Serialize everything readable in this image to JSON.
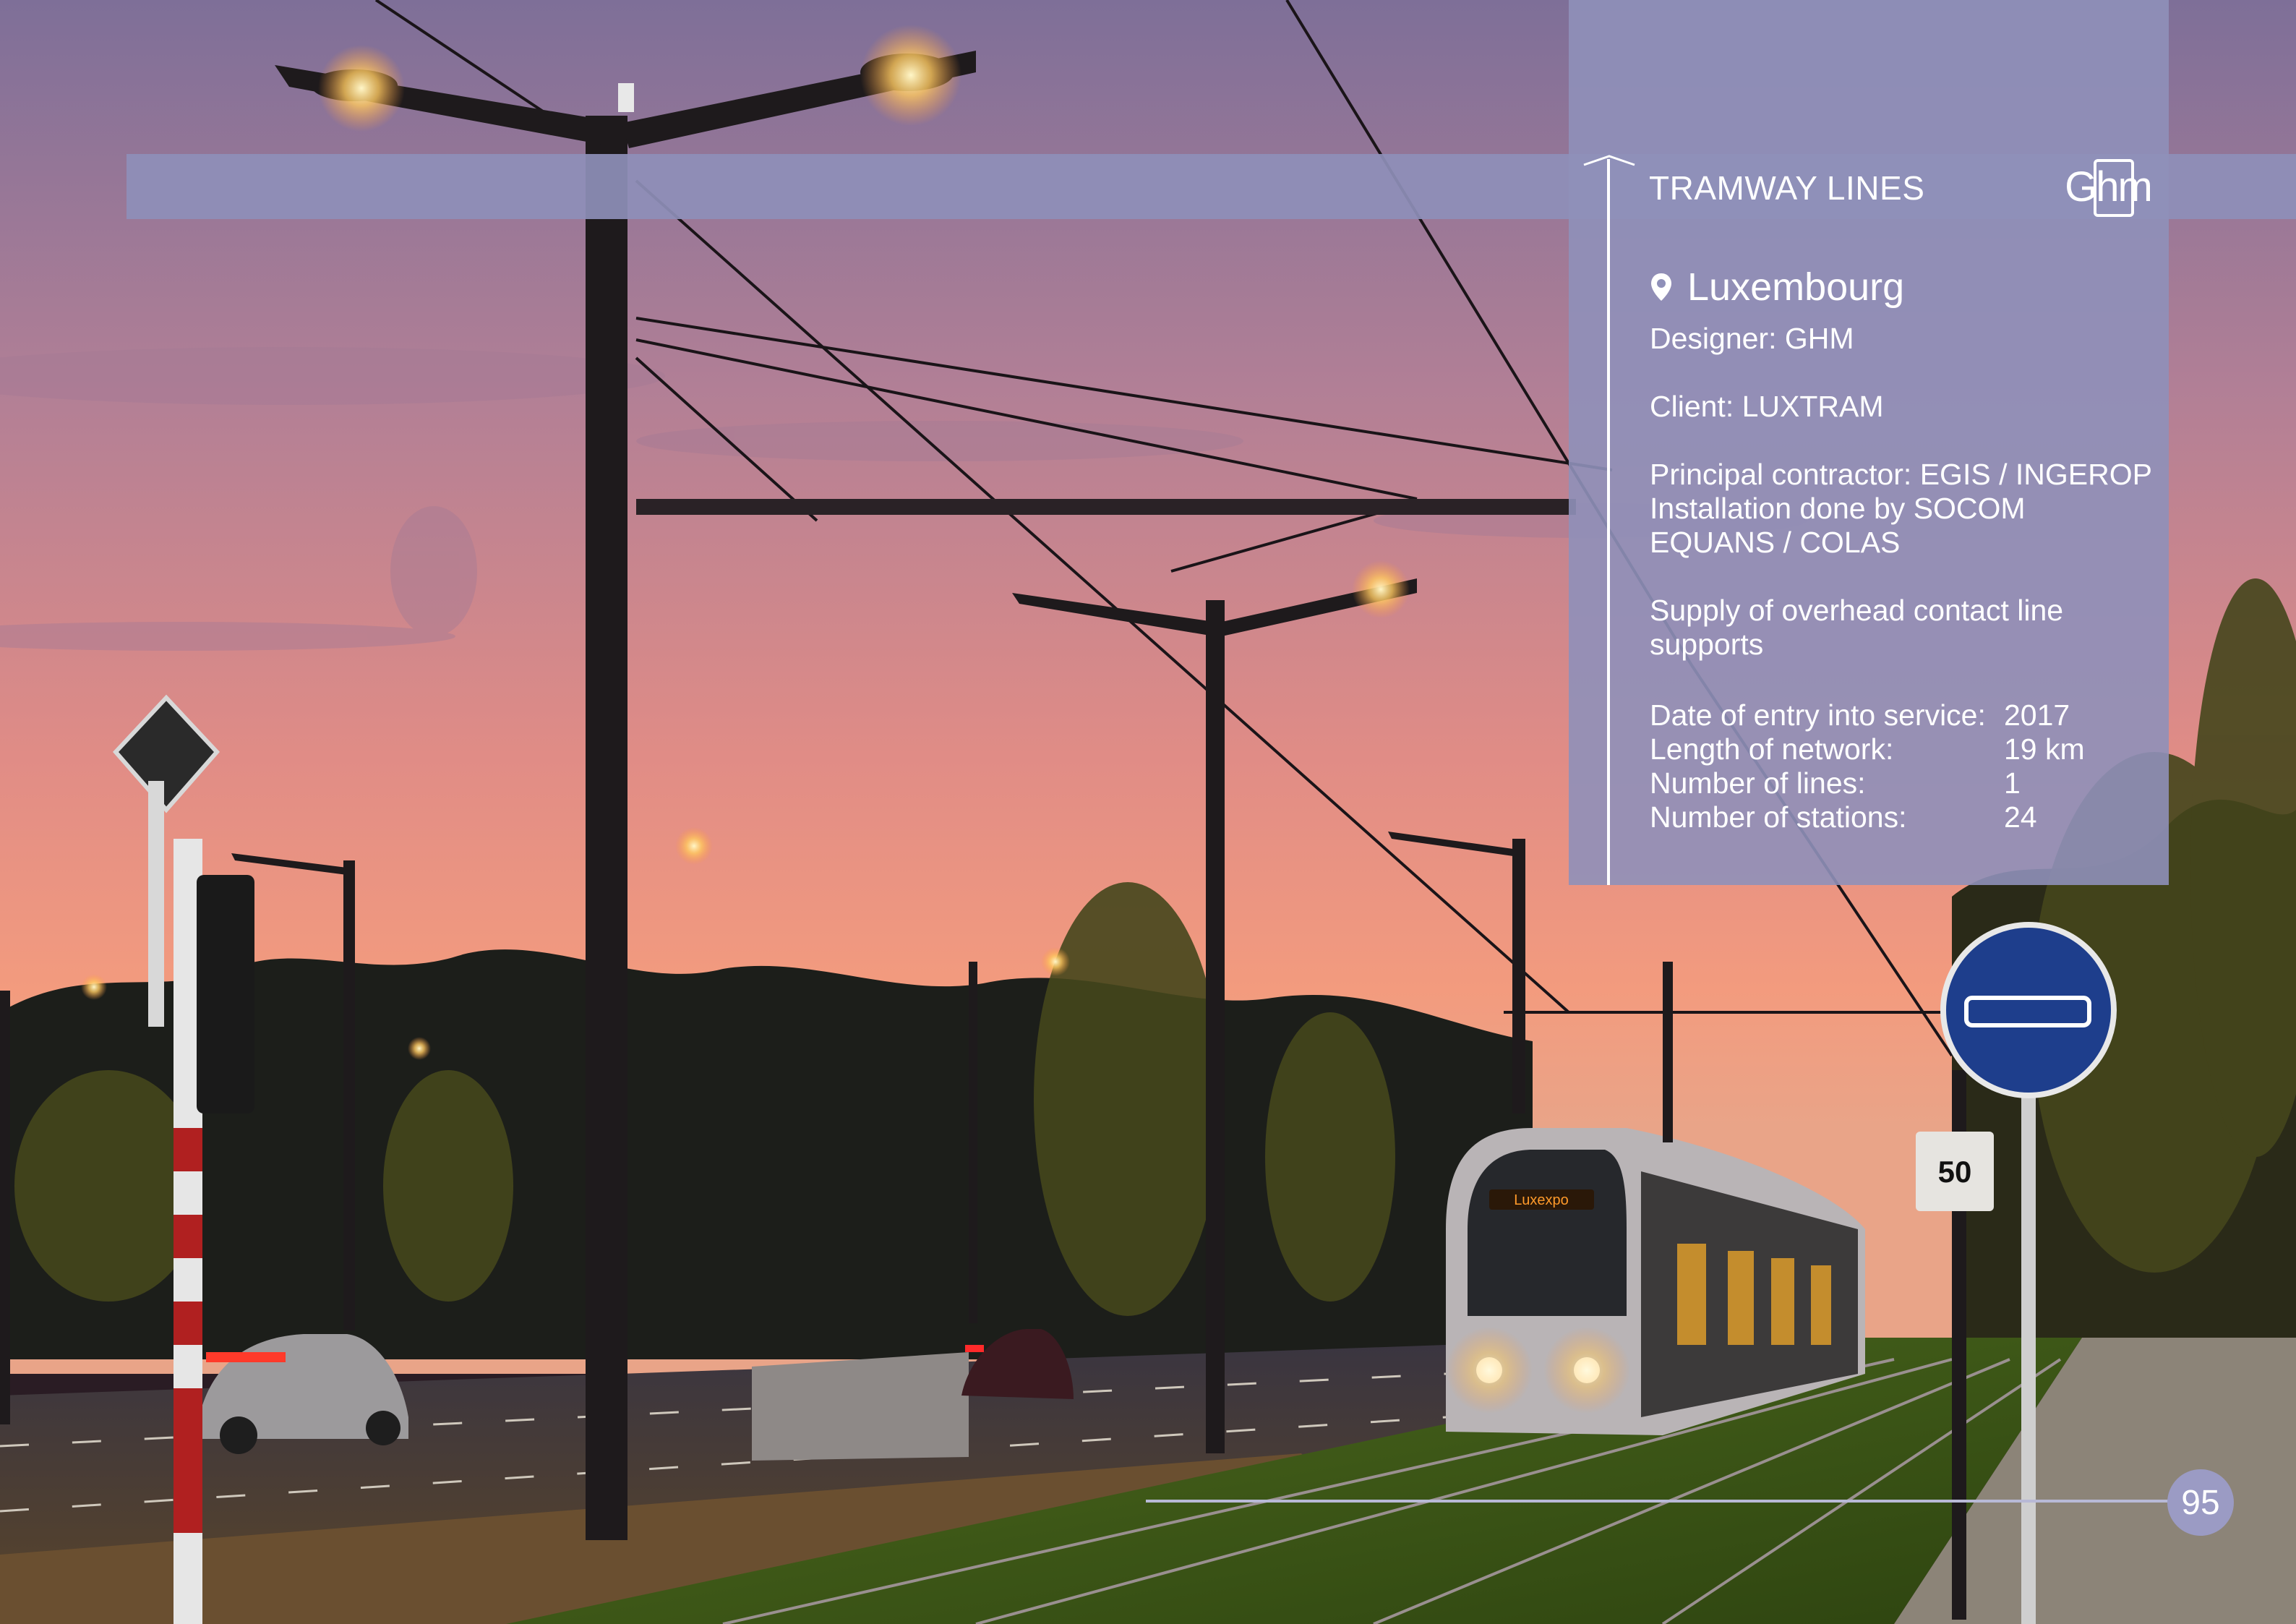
{
  "header": {
    "title": "TRAMWAY LINES",
    "logo_text": "Ghm"
  },
  "project": {
    "location": "Luxembourg",
    "designer": "Designer: GHM",
    "client": "Client: LUXTRAM",
    "contractor_line1": "Principal contractor: EGIS / INGEROP",
    "contractor_line2": "Installation done by SOCOM",
    "contractor_line3": "EQUANS / COLAS",
    "supply_line1": "Supply of overhead contact line",
    "supply_line2": "supports"
  },
  "stats": [
    {
      "label": "Date of entry into service:",
      "value": "2017"
    },
    {
      "label": "Length of network:",
      "value": "19 km"
    },
    {
      "label": "Number of lines:",
      "value": "1"
    },
    {
      "label": "Number of stations:",
      "value": "24"
    }
  ],
  "photo": {
    "tram_destination": "Luxexpo",
    "speed_sign": "50"
  },
  "footer": {
    "page_number": "95"
  },
  "colors": {
    "accent": "#8f90b9",
    "sky_top": "#7d6f9a",
    "sky_bottom": "#f1937c",
    "text": "#ffffff"
  }
}
